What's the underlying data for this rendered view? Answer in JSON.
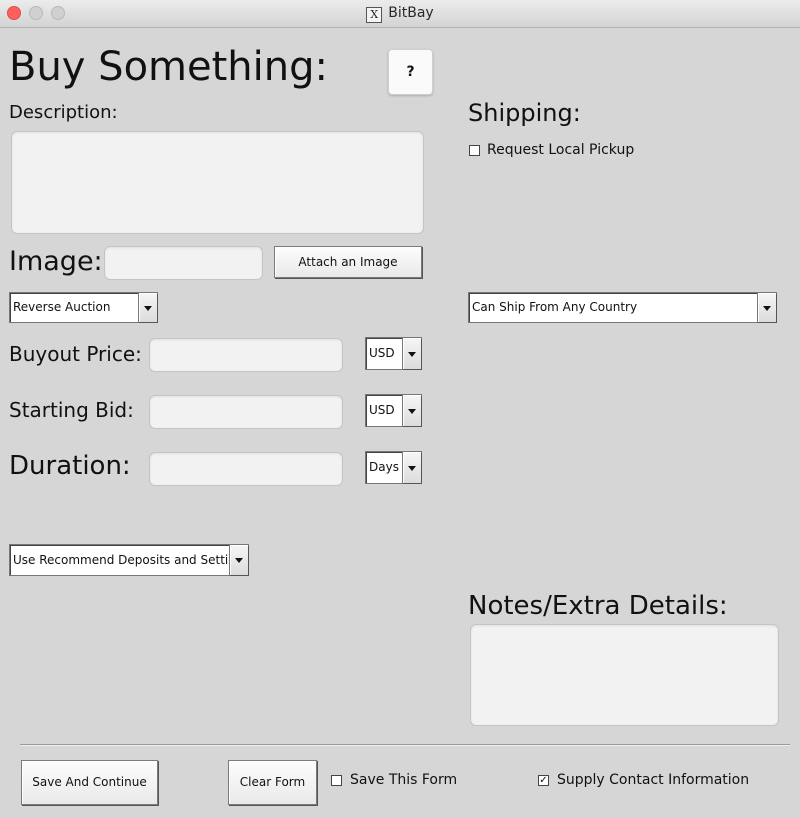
{
  "window": {
    "title": "BitBay",
    "logo_glyph": "X"
  },
  "header": {
    "title": "Buy Something:",
    "help_label": "?"
  },
  "description": {
    "label": "Description:",
    "value": ""
  },
  "shipping": {
    "label": "Shipping:",
    "local_pickup_label": "Request Local Pickup",
    "local_pickup_checked": false,
    "country_selected": "Can Ship From Any Country"
  },
  "image": {
    "label": "Image:",
    "value": "",
    "attach_label": "Attach an Image"
  },
  "auction_type": {
    "selected": "Reverse Auction"
  },
  "buyout": {
    "label": "Buyout Price:",
    "value": "",
    "currency": "USD"
  },
  "starting_bid": {
    "label": "Starting Bid:",
    "value": "",
    "currency": "USD"
  },
  "duration": {
    "label": "Duration:",
    "value": "",
    "unit": "Days"
  },
  "deposits": {
    "selected": "Use Recommend Deposits and Settings"
  },
  "notes": {
    "label": "Notes/Extra Details:",
    "value": ""
  },
  "footer": {
    "save_continue_label": "Save And Continue",
    "clear_label": "Clear Form",
    "save_form_label": "Save This Form",
    "save_form_checked": false,
    "supply_contact_label": "Supply Contact Information",
    "supply_contact_checked": true
  }
}
